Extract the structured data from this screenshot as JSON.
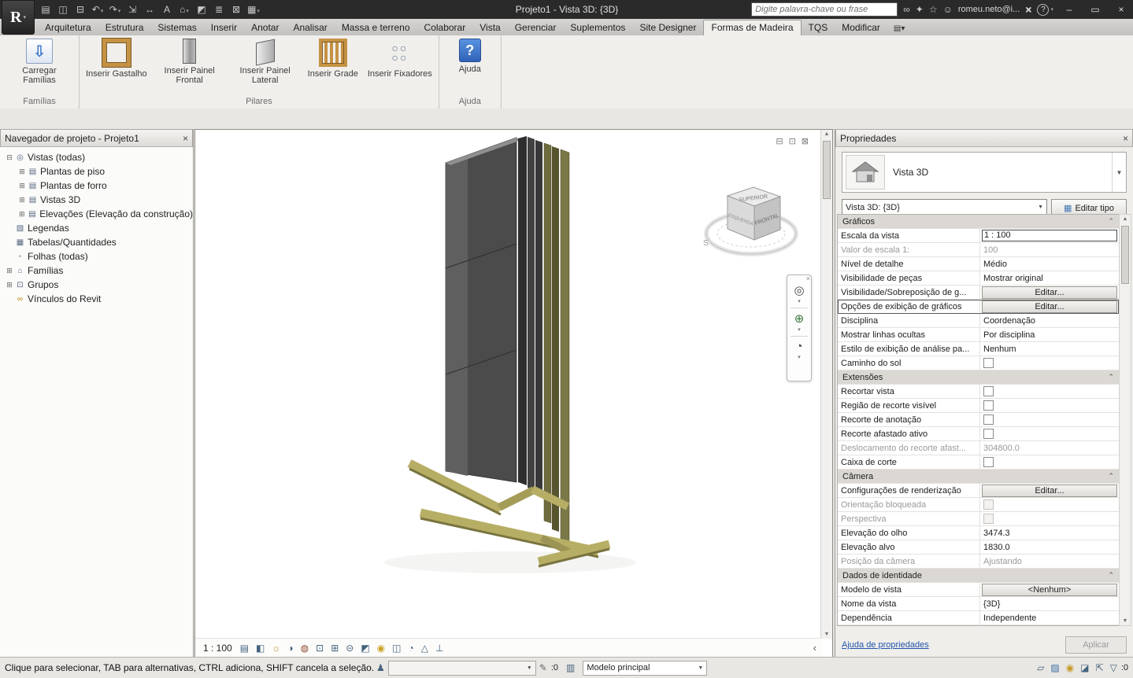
{
  "titlebar": {
    "app_button_label": "R",
    "title": "Projeto1 - Vista 3D: {3D}",
    "search_placeholder": "Digite palavra-chave ou frase",
    "user_label": "romeu.neto@i...",
    "qat_icons": [
      "open-icon",
      "save-icon",
      "print-icon",
      "undo-icon",
      "redo-icon",
      "measure-icon",
      "dimension-icon",
      "text-icon",
      "default-3d-view-icon",
      "section-icon",
      "thin-lines-icon",
      "close-inactive-icon",
      "user-interface-icon"
    ],
    "infocenter_icons": [
      "search-go-icon",
      "subscription-icon",
      "favorites-icon"
    ],
    "window_controls": [
      "minimize",
      "maximize",
      "close"
    ]
  },
  "ribbon": {
    "tabs": [
      {
        "label": "Arquitetura"
      },
      {
        "label": "Estrutura"
      },
      {
        "label": "Sistemas"
      },
      {
        "label": "Inserir"
      },
      {
        "label": "Anotar"
      },
      {
        "label": "Analisar"
      },
      {
        "label": "Massa e terreno"
      },
      {
        "label": "Colaborar"
      },
      {
        "label": "Vista"
      },
      {
        "label": "Gerenciar"
      },
      {
        "label": "Suplementos"
      },
      {
        "label": "Site Designer"
      },
      {
        "label": "Formas de Madeira",
        "active": true
      },
      {
        "label": "TQS"
      },
      {
        "label": "Modificar"
      }
    ],
    "groups": [
      {
        "label": "Famílias",
        "buttons": [
          {
            "label": "Carregar Famílias",
            "icon": "load-families-icon"
          }
        ]
      },
      {
        "label": "Pilares",
        "buttons": [
          {
            "label": "Inserir Gastalho",
            "icon": "gastalho-icon"
          },
          {
            "label": "Inserir Painel Frontal",
            "icon": "painel-frontal-icon"
          },
          {
            "label": "Inserir Painel Lateral",
            "icon": "painel-lateral-icon"
          },
          {
            "label": "Inserir Grade",
            "icon": "grade-icon"
          },
          {
            "label": "Inserir Fixadores",
            "icon": "fixadores-icon"
          }
        ]
      },
      {
        "label": "Ajuda",
        "buttons": [
          {
            "label": "Ajuda",
            "icon": "help-icon"
          }
        ]
      }
    ]
  },
  "project_browser": {
    "title": "Navegador de projeto - Projeto1",
    "tree": [
      {
        "label": "Vistas (todas)",
        "level": 0,
        "expander": "minus",
        "icon": "views-icon"
      },
      {
        "label": "Plantas de piso",
        "level": 1,
        "expander": "plus",
        "icon": "folder-icon"
      },
      {
        "label": "Plantas de forro",
        "level": 1,
        "expander": "plus",
        "icon": "folder-icon"
      },
      {
        "label": "Vistas 3D",
        "level": 1,
        "expander": "plus",
        "icon": "folder-icon"
      },
      {
        "label": "Elevações (Elevação da construção)",
        "level": 1,
        "expander": "plus",
        "icon": "folder-icon"
      },
      {
        "label": "Legendas",
        "level": 0,
        "expander": "none",
        "icon": "legend-icon"
      },
      {
        "label": "Tabelas/Quantidades",
        "level": 0,
        "expander": "none",
        "icon": "schedule-icon"
      },
      {
        "label": "Folhas (todas)",
        "level": 0,
        "expander": "none",
        "icon": "sheet-icon"
      },
      {
        "label": "Famílias",
        "level": 0,
        "expander": "plus",
        "icon": "families-icon"
      },
      {
        "label": "Grupos",
        "level": 0,
        "expander": "plus",
        "icon": "gro​ups-icon"
      },
      {
        "label": "Vínculos do Revit",
        "level": 0,
        "expander": "none",
        "icon": "link-icon"
      }
    ]
  },
  "viewport": {
    "scale_label": "1 : 100",
    "viewcube": {
      "top": "SUPERIOR",
      "front": "FRONTAL",
      "left": "ESQUERDA",
      "compass_s": "S"
    },
    "toolbar_icons": [
      "detail-level-icon",
      "visual-style-icon",
      "sun-path-icon",
      "shadows-icon",
      "render-dialog-icon",
      "crop-view-icon",
      "show-crop-icon",
      "lock-3d-icon",
      "temporary-hide-icon",
      "reveal-hidden-icon",
      "worksharing-display-icon",
      "temporary-view-properties-icon",
      "analytical-model-icon",
      "constraints-icon"
    ],
    "window_controls": [
      "minimize",
      "restore",
      "close"
    ]
  },
  "properties": {
    "title": "Propriedades",
    "type_selector": {
      "label": "Vista 3D",
      "icon": "3d-view-house-icon"
    },
    "instance_combo": "Vista 3D: {3D}",
    "edit_type_label": "Editar tipo",
    "rows": [
      {
        "kind": "group",
        "label": "Gráficos"
      },
      {
        "kind": "value",
        "label": "Escala da vista",
        "value": "1 : 100",
        "selected": true
      },
      {
        "kind": "value",
        "label": "Valor de escala    1:",
        "value": "100",
        "disabled": true
      },
      {
        "kind": "value",
        "label": "Nível de detalhe",
        "value": "Médio"
      },
      {
        "kind": "value",
        "label": "Visibilidade de peças",
        "value": "Mostrar original"
      },
      {
        "kind": "button",
        "label": "Visibilidade/Sobreposição de g...",
        "value": "Editar..."
      },
      {
        "kind": "button",
        "label": "Opções de exibição de gráficos",
        "value": "Editar...",
        "framed": true
      },
      {
        "kind": "value",
        "label": "Disciplina",
        "value": "Coordenação"
      },
      {
        "kind": "value",
        "label": "Mostrar linhas ocultas",
        "value": "Por disciplina"
      },
      {
        "kind": "value",
        "label": "Estilo de exibição de análise pa...",
        "value": "Nenhum"
      },
      {
        "kind": "checkbox",
        "label": "Caminho do sol",
        "checked": false
      },
      {
        "kind": "group",
        "label": "Extensões"
      },
      {
        "kind": "checkbox",
        "label": "Recortar vista",
        "checked": false
      },
      {
        "kind": "checkbox",
        "label": "Região de recorte visível",
        "checked": false
      },
      {
        "kind": "checkbox",
        "label": "Recorte de anotação",
        "checked": false
      },
      {
        "kind": "checkbox",
        "label": "Recorte afastado ativo",
        "checked": false
      },
      {
        "kind": "value",
        "label": "Deslocamento do recorte afast...",
        "value": "304800.0",
        "disabled": true
      },
      {
        "kind": "checkbox",
        "label": "Caixa de corte",
        "checked": false
      },
      {
        "kind": "group",
        "label": "Câmera"
      },
      {
        "kind": "button",
        "label": "Configurações de renderização",
        "value": "Editar..."
      },
      {
        "kind": "checkbox",
        "label": "Orientação bloqueada",
        "checked": false,
        "disabled": true
      },
      {
        "kind": "checkbox",
        "label": "Perspectiva",
        "checked": false,
        "disabled": true
      },
      {
        "kind": "value",
        "label": "Elevação do olho",
        "value": "3474.3"
      },
      {
        "kind": "value",
        "label": "Elevação alvo",
        "value": "1830.0"
      },
      {
        "kind": "value",
        "label": "Posição da câmera",
        "value": "Ajustando",
        "disabled": true
      },
      {
        "kind": "group",
        "label": "Dados de identidade"
      },
      {
        "kind": "button",
        "label": "Modelo de vista",
        "value": "<Nenhum>"
      },
      {
        "kind": "value",
        "label": "Nome da vista",
        "value": "{3D}"
      },
      {
        "kind": "value",
        "label": "Dependência",
        "value": "Independente"
      }
    ],
    "help_link": "Ajuda de propriedades",
    "apply_label": "Aplicar"
  },
  "statusbar": {
    "hint": "Clique para selecionar, TAB para alternativas, CTRL adiciona, SHIFT cancela a seleção.",
    "requests_count": ":0",
    "model_combo": "Modelo principal",
    "filter_count": ":0",
    "right_icons": [
      "select-links-icon",
      "select-underlays-icon",
      "select-pinned-icon",
      "select-elements-by-face-icon",
      "drag-on-selection-icon",
      "filters-icon"
    ]
  }
}
